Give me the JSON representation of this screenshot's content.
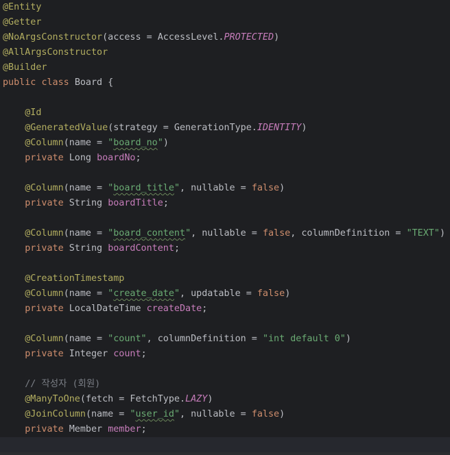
{
  "editor": {
    "language": "Java",
    "colors": {
      "background": "#1e1f22",
      "annotation": "#b3ae60",
      "keyword": "#cf8e6d",
      "string": "#6aab73",
      "field": "#c77dbb",
      "comment": "#7a7e85",
      "default": "#bcbec4"
    },
    "lines": [
      [
        {
          "t": "@Entity",
          "k": "ann"
        }
      ],
      [
        {
          "t": "@Getter",
          "k": "ann"
        }
      ],
      [
        {
          "t": "@NoArgsConstructor",
          "k": "ann"
        },
        {
          "t": "(access = AccessLevel.",
          "k": "def"
        },
        {
          "t": "PROTECTED",
          "k": "fld ital"
        },
        {
          "t": ")",
          "k": "def"
        }
      ],
      [
        {
          "t": "@AllArgsConstructor",
          "k": "ann"
        }
      ],
      [
        {
          "t": "@Builder",
          "k": "ann"
        }
      ],
      [
        {
          "t": "public ",
          "k": "kw"
        },
        {
          "t": "class ",
          "k": "kw"
        },
        {
          "t": "Board {",
          "k": "def"
        }
      ],
      [],
      [
        {
          "t": "    @Id",
          "k": "ann"
        }
      ],
      [
        {
          "t": "    @GeneratedValue",
          "k": "ann"
        },
        {
          "t": "(strategy = GenerationType.",
          "k": "def"
        },
        {
          "t": "IDENTITY",
          "k": "fld ital"
        },
        {
          "t": ")",
          "k": "def"
        }
      ],
      [
        {
          "t": "    @Column",
          "k": "ann"
        },
        {
          "t": "(name = ",
          "k": "def"
        },
        {
          "t": "\"",
          "k": "str"
        },
        {
          "t": "board_no",
          "k": "str typo"
        },
        {
          "t": "\"",
          "k": "str"
        },
        {
          "t": ")",
          "k": "def"
        }
      ],
      [
        {
          "t": "    private ",
          "k": "kw"
        },
        {
          "t": "Long ",
          "k": "def"
        },
        {
          "t": "boardNo",
          "k": "fld"
        },
        {
          "t": ";",
          "k": "def"
        }
      ],
      [],
      [
        {
          "t": "    @Column",
          "k": "ann"
        },
        {
          "t": "(name = ",
          "k": "def"
        },
        {
          "t": "\"",
          "k": "str"
        },
        {
          "t": "board_title",
          "k": "str typo"
        },
        {
          "t": "\"",
          "k": "str"
        },
        {
          "t": ", nullable = ",
          "k": "def"
        },
        {
          "t": "false",
          "k": "kw"
        },
        {
          "t": ")",
          "k": "def"
        }
      ],
      [
        {
          "t": "    private ",
          "k": "kw"
        },
        {
          "t": "String ",
          "k": "def"
        },
        {
          "t": "boardTitle",
          "k": "fld"
        },
        {
          "t": ";",
          "k": "def"
        }
      ],
      [],
      [
        {
          "t": "    @Column",
          "k": "ann"
        },
        {
          "t": "(name = ",
          "k": "def"
        },
        {
          "t": "\"",
          "k": "str"
        },
        {
          "t": "board_content",
          "k": "str typo"
        },
        {
          "t": "\"",
          "k": "str"
        },
        {
          "t": ", nullable = ",
          "k": "def"
        },
        {
          "t": "false",
          "k": "kw"
        },
        {
          "t": ", columnDefinition = ",
          "k": "def"
        },
        {
          "t": "\"TEXT\"",
          "k": "str"
        },
        {
          "t": ")",
          "k": "def"
        }
      ],
      [
        {
          "t": "    private ",
          "k": "kw"
        },
        {
          "t": "String ",
          "k": "def"
        },
        {
          "t": "boardContent",
          "k": "fld"
        },
        {
          "t": ";",
          "k": "def"
        }
      ],
      [],
      [
        {
          "t": "    @CreationTimestamp",
          "k": "ann"
        }
      ],
      [
        {
          "t": "    @Column",
          "k": "ann"
        },
        {
          "t": "(name = ",
          "k": "def"
        },
        {
          "t": "\"",
          "k": "str"
        },
        {
          "t": "create_date",
          "k": "str typo"
        },
        {
          "t": "\"",
          "k": "str"
        },
        {
          "t": ", updatable = ",
          "k": "def"
        },
        {
          "t": "false",
          "k": "kw"
        },
        {
          "t": ")",
          "k": "def"
        }
      ],
      [
        {
          "t": "    private ",
          "k": "kw"
        },
        {
          "t": "LocalDateTime ",
          "k": "def"
        },
        {
          "t": "createDate",
          "k": "fld"
        },
        {
          "t": ";",
          "k": "def"
        }
      ],
      [],
      [
        {
          "t": "    @Column",
          "k": "ann"
        },
        {
          "t": "(name = ",
          "k": "def"
        },
        {
          "t": "\"count\"",
          "k": "str"
        },
        {
          "t": ", columnDefinition = ",
          "k": "def"
        },
        {
          "t": "\"int default 0\"",
          "k": "str"
        },
        {
          "t": ")",
          "k": "def"
        }
      ],
      [
        {
          "t": "    private ",
          "k": "kw"
        },
        {
          "t": "Integer ",
          "k": "def"
        },
        {
          "t": "count",
          "k": "fld"
        },
        {
          "t": ";",
          "k": "def"
        }
      ],
      [],
      [
        {
          "t": "    // 작성자 (회원)",
          "k": "cmt"
        }
      ],
      [
        {
          "t": "    @ManyToOne",
          "k": "ann"
        },
        {
          "t": "(fetch = FetchType.",
          "k": "def"
        },
        {
          "t": "LAZY",
          "k": "fld ital"
        },
        {
          "t": ")",
          "k": "def"
        }
      ],
      [
        {
          "t": "    @JoinColumn",
          "k": "ann"
        },
        {
          "t": "(name = ",
          "k": "def"
        },
        {
          "t": "\"",
          "k": "str"
        },
        {
          "t": "user_id",
          "k": "str typo"
        },
        {
          "t": "\"",
          "k": "str"
        },
        {
          "t": ", nullable = ",
          "k": "def"
        },
        {
          "t": "false",
          "k": "kw"
        },
        {
          "t": ")",
          "k": "def"
        }
      ],
      [
        {
          "t": "    private ",
          "k": "kw"
        },
        {
          "t": "Member ",
          "k": "def"
        },
        {
          "t": "member",
          "k": "fld"
        },
        {
          "t": ";",
          "k": "def"
        }
      ],
      []
    ]
  }
}
